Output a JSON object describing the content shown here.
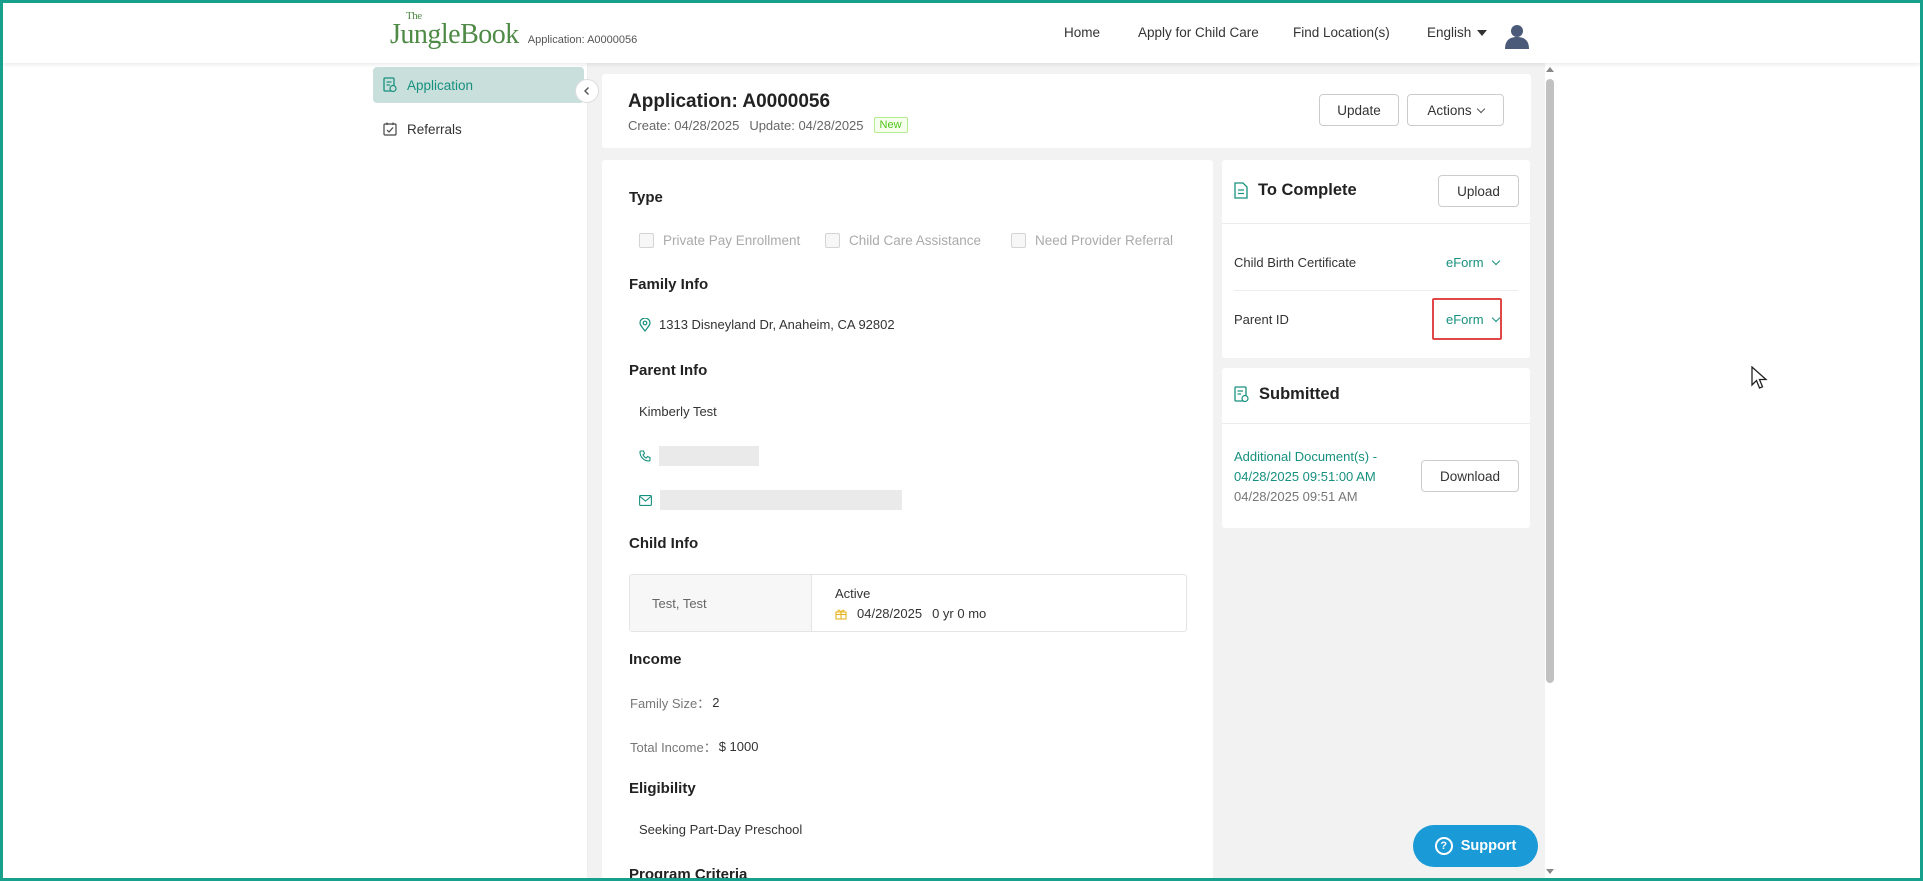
{
  "header": {
    "logo_the": "The",
    "logo_main": "JungleBook",
    "app_ref": "Application: A0000056",
    "nav": [
      "Home",
      "Apply for Child Care",
      "Find Location(s)"
    ],
    "language": "English"
  },
  "sidebar": {
    "items": [
      {
        "label": "Application",
        "icon": "application-icon",
        "active": true
      },
      {
        "label": "Referrals",
        "icon": "checklist-icon",
        "active": false
      }
    ]
  },
  "application": {
    "title": "Application: A0000056",
    "create": "Create: 04/28/2025",
    "update": "Update: 04/28/2025",
    "status": "New",
    "update_button": "Update",
    "actions_button": "Actions"
  },
  "details": {
    "type_title": "Type",
    "type_options": [
      "Private Pay Enrollment",
      "Child Care Assistance",
      "Need Provider Referral"
    ],
    "family_title": "Family Info",
    "address": "1313 Disneyland Dr, Anaheim, CA 92802",
    "parent_title": "Parent Info",
    "parent_name": "Kimberly Test",
    "child_title": "Child Info",
    "child_name": "Test, Test",
    "child_status": "Active",
    "child_dob": "04/28/2025",
    "child_age": "0 yr 0 mo",
    "income_title": "Income",
    "family_size_label": "Family Size：",
    "family_size": "2",
    "total_income_label": "Total Income：",
    "total_income": "$ 1000",
    "eligibility_title": "Eligibility",
    "eligibility_value": "Seeking Part-Day Preschool",
    "program_title": "Program Criteria"
  },
  "to_complete": {
    "title": "To Complete",
    "upload_button": "Upload",
    "docs": [
      {
        "name": "Child Birth Certificate",
        "action": "eForm"
      },
      {
        "name": "Parent ID",
        "action": "eForm"
      }
    ]
  },
  "submitted": {
    "title": "Submitted",
    "link": "Additional Document(s) - 04/28/2025 09:51:00 AM",
    "date": "04/28/2025 09:51 AM",
    "download_button": "Download"
  },
  "support": {
    "label": "Support"
  },
  "colors": {
    "accent": "#17907f",
    "support": "#1a9ad6",
    "highlight": "#e04848",
    "frame": "#17a08c"
  }
}
